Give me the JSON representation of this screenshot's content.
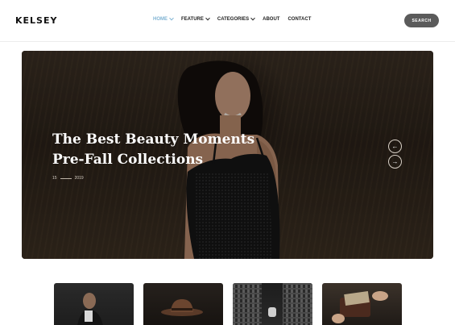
{
  "header": {
    "logo": "KELSEY",
    "nav": [
      {
        "label": "HOME",
        "dropdown": true,
        "active": true
      },
      {
        "label": "FEATURE",
        "dropdown": true,
        "active": false
      },
      {
        "label": "CATEGORIES",
        "dropdown": true,
        "active": false
      },
      {
        "label": "ABOUT",
        "dropdown": false,
        "active": false
      },
      {
        "label": "CONTACT",
        "dropdown": false,
        "active": false
      }
    ],
    "search_label": "SEARCH"
  },
  "hero": {
    "title_line1": "The Best Beauty Moments",
    "title_line2": "Pre-Fall Collections",
    "meta_day": "15",
    "meta_year": "2019",
    "prev_icon": "←",
    "next_icon": "→"
  },
  "thumbnails": [
    {
      "icon": "man-in-suit-photo"
    },
    {
      "icon": "hat-photo"
    },
    {
      "icon": "plaid-shirt-watch-photo"
    },
    {
      "icon": "wallet-money-photo"
    }
  ],
  "colors": {
    "nav_active": "#7fb3d3",
    "search_button": "#5b5b5b",
    "hero_text": "#ffffff"
  }
}
